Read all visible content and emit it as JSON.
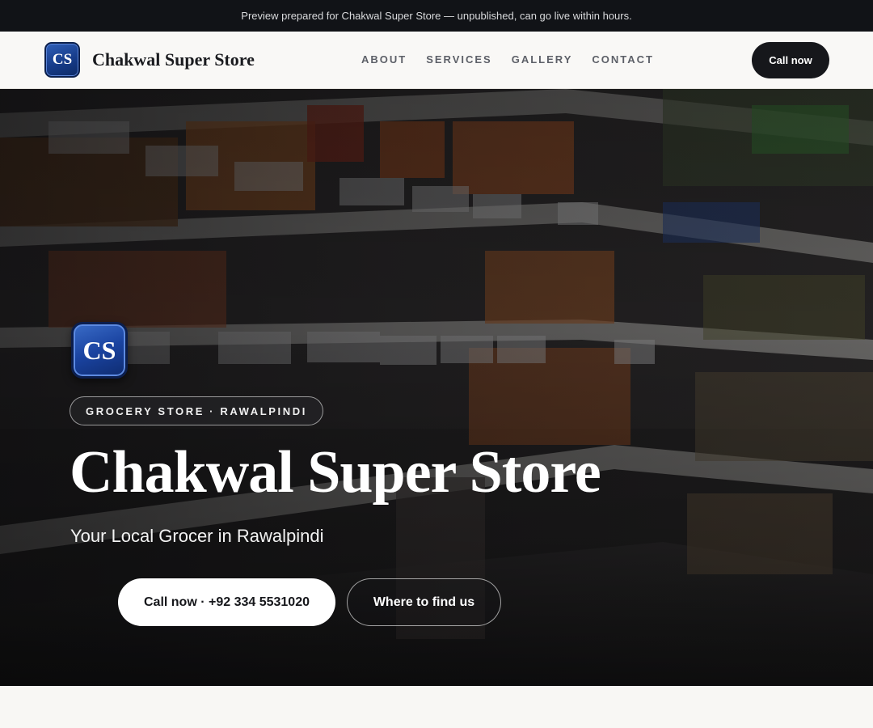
{
  "banner": {
    "text": "Preview prepared for Chakwal Super Store — unpublished, can go live within hours."
  },
  "header": {
    "logo_initials": "CS",
    "brand_name": "Chakwal Super Store",
    "nav": [
      {
        "label": "ABOUT"
      },
      {
        "label": "SERVICES"
      },
      {
        "label": "GALLERY"
      },
      {
        "label": "CONTACT"
      }
    ],
    "call_label": "Call now"
  },
  "hero": {
    "logo_initials": "CS",
    "tag": "GROCERY STORE · RAWALPINDI",
    "title": "Chakwal Super Store",
    "subtitle": "Your Local Grocer in Rawalpindi",
    "primary_button": "Call now · +92 334 5531020",
    "secondary_button": "Where to find us",
    "background_image": "supermarket-shelves-photo"
  },
  "colors": {
    "banner_bg": "#111317",
    "header_bg": "#f9f8f6",
    "dark_button": "#16171b",
    "logo_blue": "#1a43a0"
  }
}
